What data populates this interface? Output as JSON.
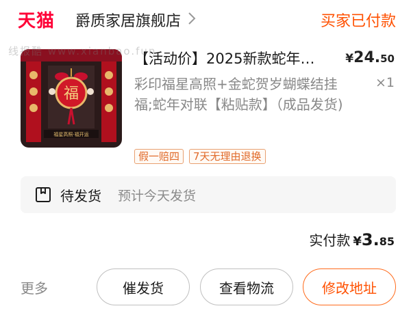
{
  "header": {
    "platform_logo": "天猫",
    "store_name": "爵质家居旗舰店",
    "order_status": "买家已付款"
  },
  "watermark": "线报酷 www.xianbao.fun",
  "item": {
    "title": "【活动价】2025新款蛇年…",
    "price_currency": "¥",
    "price_int": "24.",
    "price_dec": "50",
    "spec": "彩印福星高照+金蛇贺岁蝴蝶结挂福;蛇年对联【粘贴款】（成品发货)",
    "quantity": "×1",
    "thumbnail_label": "福星高照·福开运",
    "tags": [
      "假一赔四",
      "7天无理由退换"
    ]
  },
  "shipping": {
    "status": "待发货",
    "note": "预计今天发货"
  },
  "payment": {
    "label": "实付款",
    "currency": "¥",
    "int": "3.",
    "dec": "85"
  },
  "actions": {
    "more": "更多",
    "urge": "催发货",
    "logistics": "查看物流",
    "change_address": "修改地址"
  },
  "colors": {
    "brand": "#ff0036",
    "accent": "#ff5000",
    "thumb_bg": "#2a1a1a",
    "thumb_red": "#c8102e"
  }
}
